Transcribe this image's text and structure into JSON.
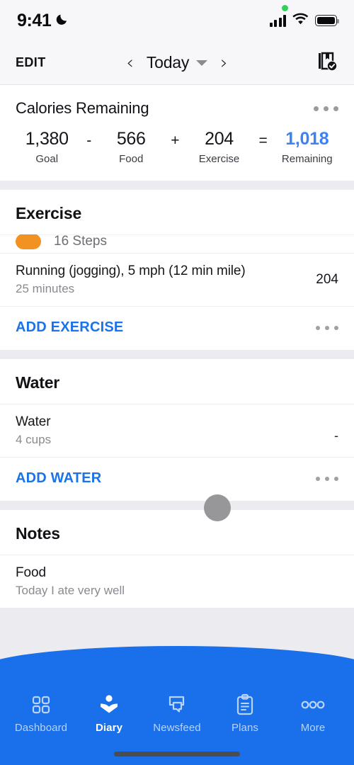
{
  "status_bar": {
    "time": "9:41",
    "dnd_icon": "moon-icon",
    "signal_icon": "cellular-signal-icon",
    "wifi_icon": "wifi-icon",
    "battery_icon": "battery-icon",
    "recording_dot": "green-recording-dot"
  },
  "nav": {
    "edit_label": "EDIT",
    "prev_icon": "chevron-left-icon",
    "date_label": "Today",
    "dropdown_icon": "caret-down-icon",
    "next_icon": "chevron-right-icon",
    "diary_complete_icon": "book-check-icon"
  },
  "calories": {
    "title": "Calories Remaining",
    "menu_icon": "more-options-icon",
    "items": [
      {
        "value": "1,380",
        "label": "Goal"
      },
      {
        "value": "566",
        "label": "Food"
      },
      {
        "value": "204",
        "label": "Exercise"
      },
      {
        "value": "1,018",
        "label": "Remaining"
      }
    ],
    "operators": [
      "-",
      "+",
      "="
    ],
    "accent_color": "#3B82F6"
  },
  "exercise": {
    "title": "Exercise",
    "clipped_row": {
      "label": "16 Steps",
      "pill_color": "#F29222"
    },
    "entries": [
      {
        "title": "Running (jogging), 5 mph (12 min mile)",
        "sub": "25 minutes",
        "value": "204"
      }
    ],
    "add_label": "ADD EXERCISE",
    "menu_icon": "more-options-icon"
  },
  "water": {
    "title": "Water",
    "entries": [
      {
        "title": "Water",
        "sub": "4 cups",
        "value": "-"
      }
    ],
    "add_label": "ADD WATER",
    "menu_icon": "more-options-icon"
  },
  "notes": {
    "title": "Notes",
    "entries": [
      {
        "title": "Food",
        "sub": "Today I ate very well"
      }
    ]
  },
  "tabbar": {
    "background_color": "#1A6FEB",
    "items": [
      {
        "label": "Dashboard",
        "icon": "grid-icon",
        "active": false
      },
      {
        "label": "Diary",
        "icon": "open-book-icon",
        "active": true
      },
      {
        "label": "Newsfeed",
        "icon": "chat-bubbles-icon",
        "active": false
      },
      {
        "label": "Plans",
        "icon": "clipboard-icon",
        "active": false
      },
      {
        "label": "More",
        "icon": "more-dots-icon",
        "active": false
      }
    ],
    "home_indicator": "home-indicator-bar"
  },
  "cursor": {
    "name": "touch-cursor"
  }
}
